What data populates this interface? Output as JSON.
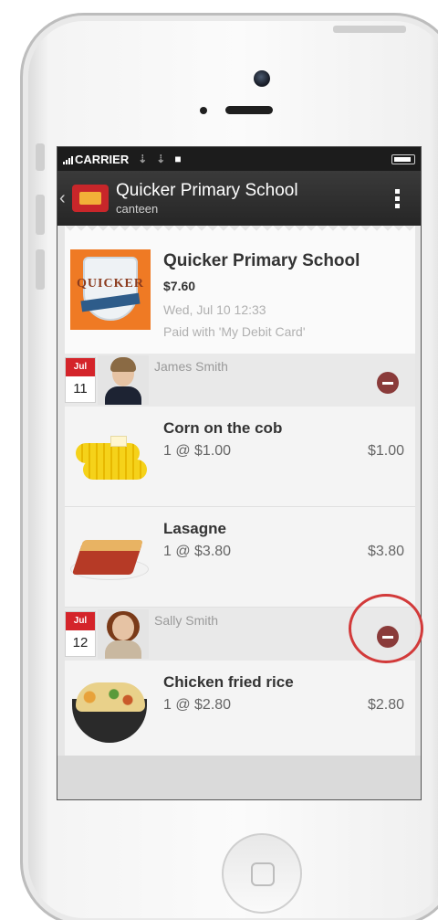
{
  "status_bar": {
    "carrier": "CARRIER"
  },
  "app_bar": {
    "title": "Quicker Primary School",
    "subtitle": "canteen"
  },
  "order": {
    "logo_text": "QUICKER",
    "title": "Quicker Primary School",
    "price": "$7.60",
    "datetime": "Wed, Jul 10 12:33",
    "payment": "Paid with 'My Debit Card'"
  },
  "students": [
    {
      "month": "Jul",
      "day": "11",
      "name": "James Smith",
      "items": [
        {
          "title": "Corn on the cob",
          "qty": "1 @ $1.00",
          "total": "$1.00"
        },
        {
          "title": "Lasagne",
          "qty": "1 @ $3.80",
          "total": "$3.80"
        }
      ]
    },
    {
      "month": "Jul",
      "day": "12",
      "name": "Sally Smith",
      "items": [
        {
          "title": "Chicken fried rice",
          "qty": "1 @ $2.80",
          "total": "$2.80"
        }
      ]
    }
  ],
  "colors": {
    "accent_red": "#d4242a",
    "remove_button": "#8a3b3a",
    "logo_orange": "#ef7a24"
  },
  "icons": [
    "signal-icon",
    "usb-icon",
    "lock-icon",
    "battery-icon",
    "back-chevron-icon",
    "overflow-menu-icon",
    "remove-icon",
    "home-button"
  ]
}
